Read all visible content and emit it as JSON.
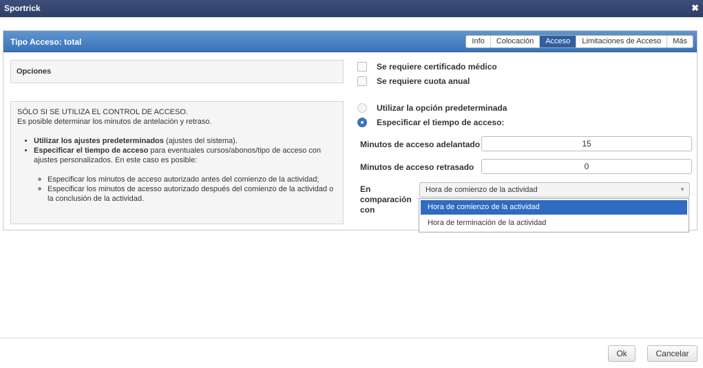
{
  "window": {
    "title": "Sportrick",
    "close_glyph": "✖"
  },
  "panel": {
    "title": "Tipo Acceso: total"
  },
  "tabs": [
    {
      "label": "Info",
      "active": false
    },
    {
      "label": "Colocación",
      "active": false
    },
    {
      "label": "Acceso",
      "active": true
    },
    {
      "label": "Limitaciones de Acceso",
      "active": false
    },
    {
      "label": "Más",
      "active": false
    }
  ],
  "options": {
    "label": "Opciones"
  },
  "checkboxes": [
    {
      "label": "Se requiere certificado médico",
      "checked": false
    },
    {
      "label": "Se requiere cuota anual",
      "checked": false
    }
  ],
  "help": {
    "line1": "SÓLO SI SE UTILIZA EL CONTROL DE ACCESO.",
    "line2": "Es posible determinar los minutos de antelación y retraso.",
    "bullet1_bold": "Utilizar los ajustes predeterminados",
    "bullet1_rest": " (ajustes del sistema).",
    "bullet2_bold": "Especificar el tiempo de acceso",
    "bullet2_rest": " para eventuales cursos/abonos/tipo de acceso con ajustes personalizados. En este caso es posible:",
    "sub1": "Especificar los minutos de acceso autorizado antes del comienzo de la actividad;",
    "sub2": "Especificar los minutos de acesso autorizado después del comienzo de la actividad o la conclusión de la actividad."
  },
  "radios": [
    {
      "label": "Utilizar la opción predeterminada",
      "selected": false
    },
    {
      "label": "Especificar el tiempo de acceso:",
      "selected": true
    }
  ],
  "fields": {
    "advance_label": "Minutos de acceso adelantado",
    "advance_value": "15",
    "late_label": "Minutos de acceso retrasado",
    "late_value": "0",
    "compare_label": "En comparación con",
    "compare_value": "Hora de comienzo de la actividad",
    "caret": "▼"
  },
  "dropdown_options": [
    {
      "label": "Hora de comienzo de la actividad",
      "selected": true
    },
    {
      "label": "Hora de terminación de la actividad",
      "selected": false
    }
  ],
  "buttons": {
    "ok": "Ok",
    "cancel": "Cancelar"
  },
  "colors": {
    "accent": "#3a73b8",
    "titlebar": "#34466f",
    "selection": "#2f6bc0"
  }
}
